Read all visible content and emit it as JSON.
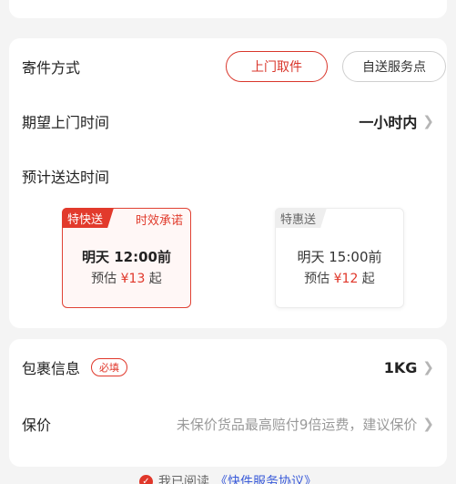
{
  "top": {
    "cut_text": ""
  },
  "send_method": {
    "label": "寄件方式",
    "options": [
      "上门取件",
      "自送服务点"
    ],
    "selected": "上门取件"
  },
  "pickup_time": {
    "label": "期望上门时间",
    "value": "一小时内"
  },
  "delivery": {
    "label": "预计送达时间",
    "options": [
      {
        "tag": "特快送",
        "promise": "时效承诺",
        "time": "明天 12:00前",
        "est_prefix": "预估 ",
        "price": "¥13",
        "est_suffix": " 起",
        "selected": true
      },
      {
        "tag": "特惠送",
        "promise": "",
        "time": "明天 15:00前",
        "est_prefix": "预估 ",
        "price": "¥12",
        "est_suffix": " 起",
        "selected": false
      }
    ]
  },
  "package": {
    "label": "包裹信息",
    "required_badge": "必填",
    "value": "1KG"
  },
  "insurance": {
    "label": "保价",
    "hint": "未保价货品最高赔付9倍运费，建议保价"
  },
  "agreement": {
    "prefix": "我已阅读",
    "link": "《快件服务协议》"
  },
  "colors": {
    "accent": "#e0372a",
    "link": "#3a5bd9",
    "background": "#f4f4f4"
  },
  "icons": {
    "chevron": "chevron-right-icon",
    "check": "check-circle-icon"
  }
}
